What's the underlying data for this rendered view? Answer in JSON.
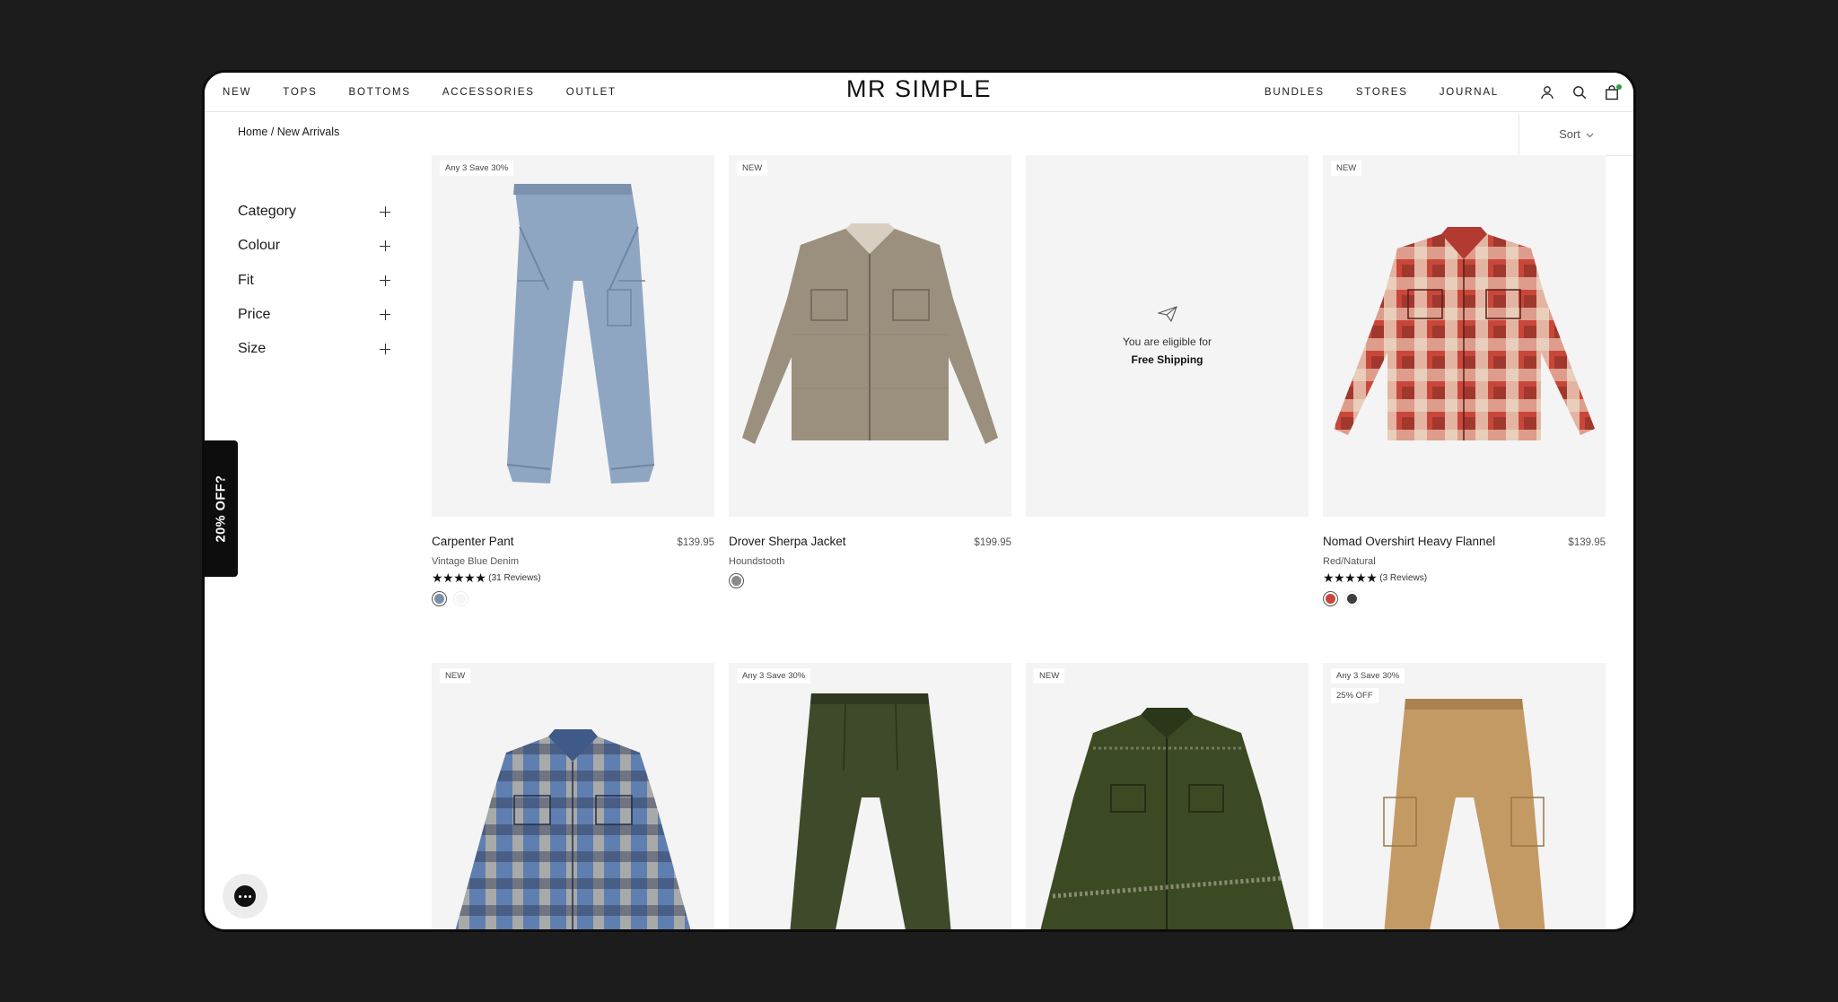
{
  "header": {
    "logo": "MR SIMPLE",
    "nav_left": [
      "NEW",
      "TOPS",
      "BOTTOMS",
      "ACCESSORIES",
      "OUTLET"
    ],
    "nav_right": [
      "BUNDLES",
      "STORES",
      "JOURNAL"
    ],
    "icons": [
      "account-icon",
      "search-icon",
      "cart-icon"
    ]
  },
  "breadcrumb": {
    "home": "Home",
    "separator": " / ",
    "current": "New Arrivals"
  },
  "sort": {
    "label": "Sort"
  },
  "filters": [
    "Category",
    "Colour",
    "Fit",
    "Price",
    "Size"
  ],
  "promo_tab": {
    "label": "20% OFF?"
  },
  "shipping_notice": {
    "line1": "You are eligible for",
    "line2": "Free Shipping"
  },
  "products": [
    {
      "badge": "Any 3 Save 30%",
      "name": "Carpenter Pant",
      "price": "$139.95",
      "variant": "Vintage Blue Denim",
      "stars": "★★★★★",
      "reviews": "(31 Reviews)",
      "swatches": [
        "#7d8fa8",
        "#f6f6f6"
      ]
    },
    {
      "badge": "NEW",
      "name": "Drover Sherpa Jacket",
      "price": "$199.95",
      "variant": "Houndstooth",
      "swatches": [
        "#8a8a8a"
      ]
    },
    {
      "badge": "NEW",
      "name": "Nomad Overshirt Heavy Flannel",
      "price": "$139.95",
      "variant": "Red/Natural",
      "stars": "★★★★★",
      "reviews": "(3 Reviews)",
      "swatches": [
        "#c9473a",
        "#3f3f3f"
      ]
    },
    {
      "badge": "NEW"
    },
    {
      "badge": "Any 3 Save 30%"
    },
    {
      "badge": "NEW"
    },
    {
      "badge": "Any 3 Save 30%",
      "badge2": "25% OFF"
    }
  ],
  "colors": {
    "background": "#1c1c1c",
    "card": "#f4f4f4",
    "cart_dot": "#2e9c3e"
  }
}
